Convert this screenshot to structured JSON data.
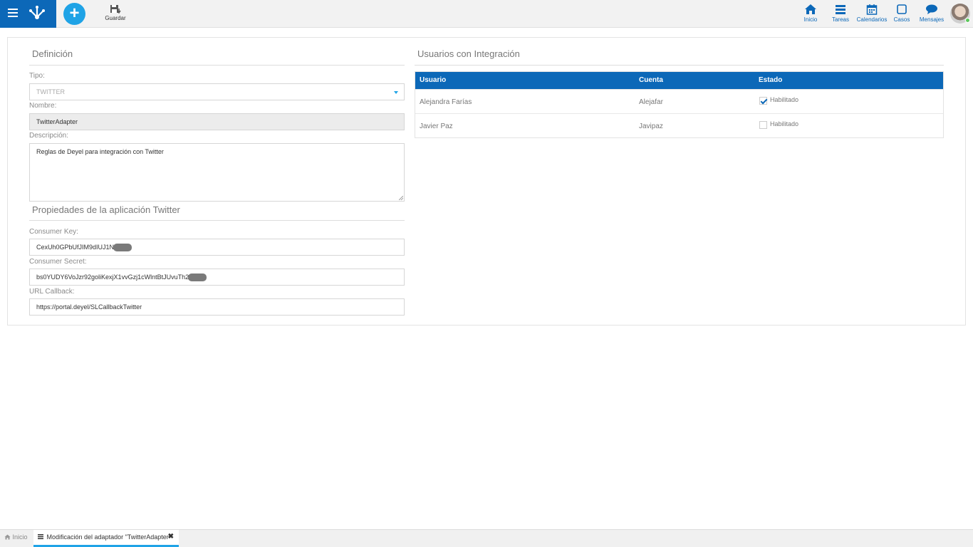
{
  "toolbar": {
    "save_label": "Guardar"
  },
  "nav": {
    "inicio": "Inicio",
    "tareas": "Tareas",
    "calendarios": "Calendarios",
    "casos": "Casos",
    "mensajes": "Mensajes"
  },
  "definition": {
    "title": "Definición",
    "tipo_label": "Tipo:",
    "tipo_value": "TWITTER",
    "nombre_label": "Nombre:",
    "nombre_value": "TwitterAdapter",
    "descripcion_label": "Descripción:",
    "descripcion_value": "Reglas de Deyel para integración con Twitter"
  },
  "properties": {
    "title": "Propiedades de la aplicación Twitter",
    "consumer_key_label": "Consumer Key:",
    "consumer_key_value": "CexUh0GPbUfJIM9dIUJ1N",
    "consumer_secret_label": "Consumer Secret:",
    "consumer_secret_value": "bs0YUDY6VoJzr92goliKexjX1vvGzj1cWlntBtJUvuTh2",
    "url_callback_label": "URL Callback:",
    "url_callback_value": "https://portal.deyel/SLCallbackTwitter"
  },
  "users": {
    "title": "Usuarios con Integración",
    "columns": [
      "Usuario",
      "Cuenta",
      "Estado"
    ],
    "rows": [
      {
        "usuario": "Alejandra Farías",
        "cuenta": "Alejafar",
        "estado": "Habilitado",
        "checked": true
      },
      {
        "usuario": "Javier Paz",
        "cuenta": "Javipaz",
        "estado": "Habilitado",
        "checked": false
      }
    ]
  },
  "bottom": {
    "home_tab": "Inicio",
    "active_tab": "Modificación del adaptador \"TwitterAdapter\"",
    "close": "✖"
  },
  "colors": {
    "brand": "#0c68b8",
    "accent": "#1fa3e6"
  }
}
